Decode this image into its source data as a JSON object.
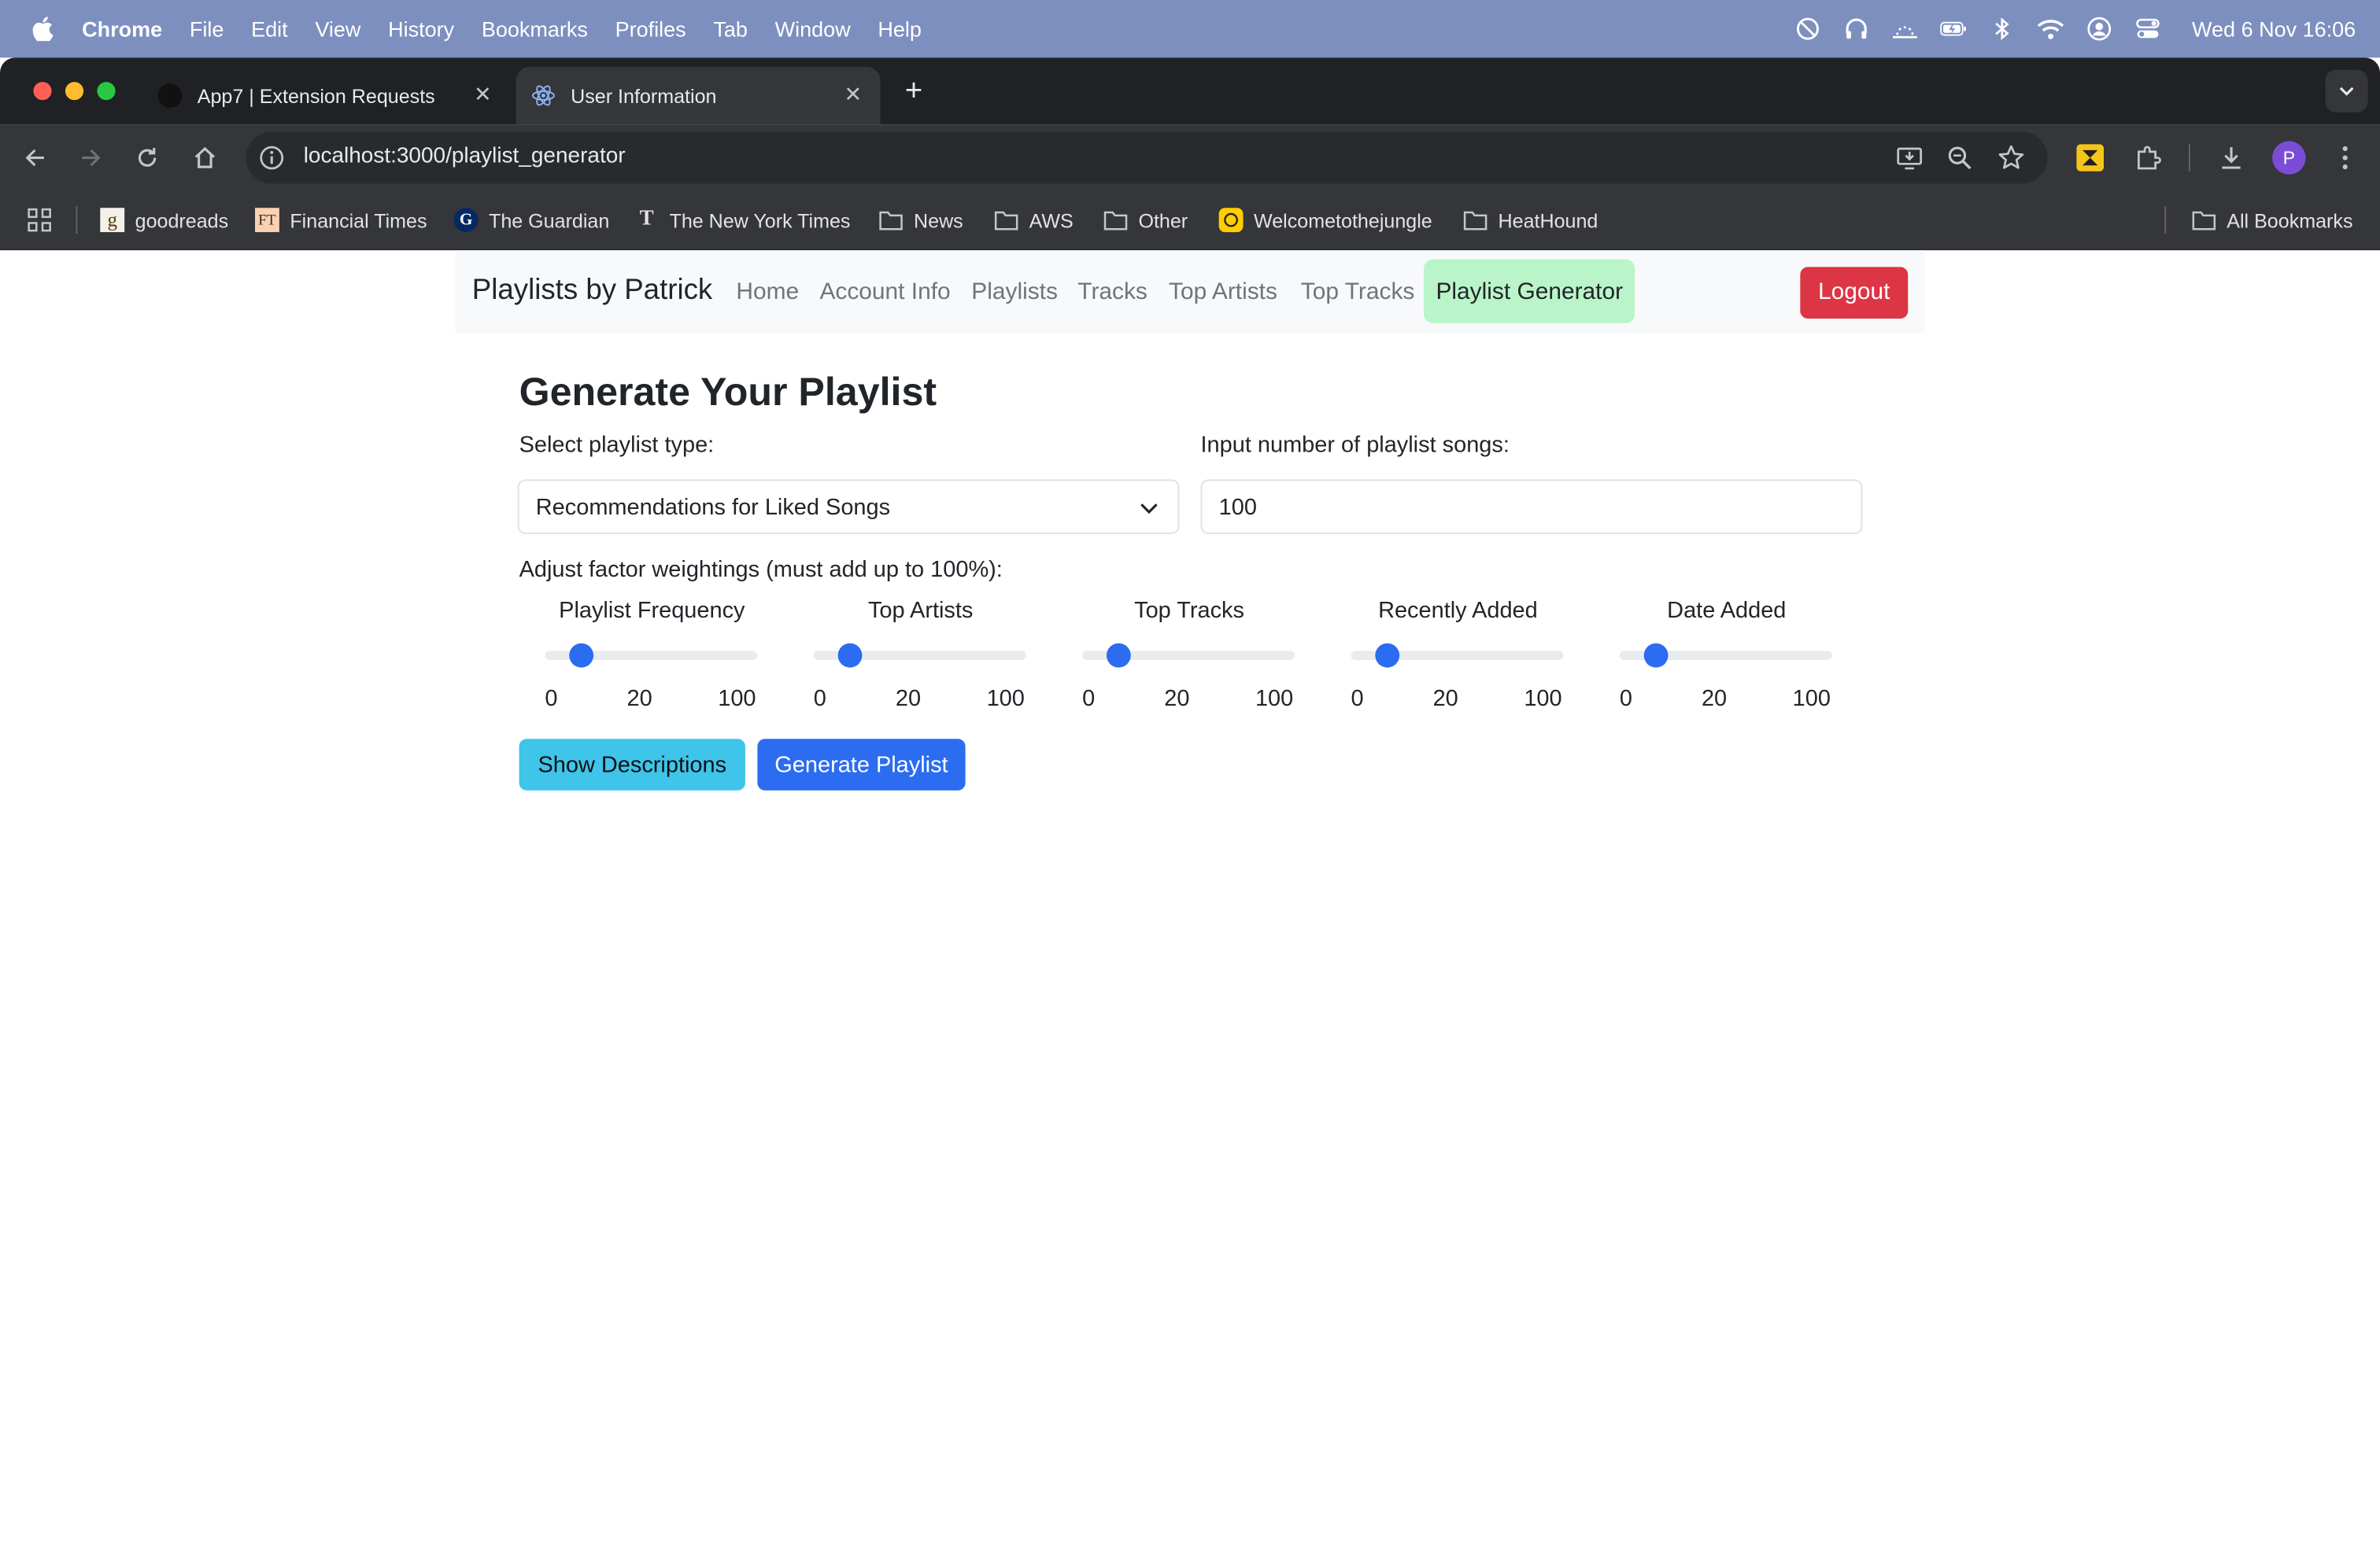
{
  "menubar": {
    "app_name": "Chrome",
    "menus": [
      "File",
      "Edit",
      "View",
      "History",
      "Bookmarks",
      "Profiles",
      "Tab",
      "Window",
      "Help"
    ],
    "clock": "Wed 6 Nov  16:06"
  },
  "tabs": [
    {
      "title": "App7 | Extension Requests",
      "active": false
    },
    {
      "title": "User Information",
      "active": true
    }
  ],
  "address_bar": {
    "url": "localhost:3000/playlist_generator"
  },
  "profile_initial": "P",
  "bookmarks": [
    {
      "label": "goodreads",
      "icon": "goodreads-icon"
    },
    {
      "label": "Financial Times",
      "icon": "ft-icon"
    },
    {
      "label": "The Guardian",
      "icon": "guardian-icon"
    },
    {
      "label": "The New York Times",
      "icon": "nyt-icon"
    },
    {
      "label": "News",
      "icon": "folder-icon"
    },
    {
      "label": "AWS",
      "icon": "folder-icon"
    },
    {
      "label": "Other",
      "icon": "folder-icon"
    },
    {
      "label": "Welcometothejungle",
      "icon": "wttj-icon"
    },
    {
      "label": "HeatHound",
      "icon": "folder-icon"
    }
  ],
  "all_bookmarks_label": "All Bookmarks",
  "navbar": {
    "brand": "Playlists by Patrick",
    "links": [
      "Home",
      "Account Info",
      "Playlists",
      "Tracks",
      "Top Artists",
      "Top Tracks"
    ],
    "active_link": "Playlist Generator",
    "logout_label": "Logout"
  },
  "form": {
    "title": "Generate Your Playlist",
    "type_label": "Select playlist type:",
    "type_value": "Recommendations for Liked Songs",
    "count_label": "Input number of playlist songs:",
    "count_value": "100",
    "weights_label": "Adjust factor weightings (must add up to 100%):",
    "factors": [
      {
        "name": "Playlist Frequency",
        "min": "0",
        "mid": "20",
        "max": "100",
        "value": 20
      },
      {
        "name": "Top Artists",
        "min": "0",
        "mid": "20",
        "max": "100",
        "value": 20
      },
      {
        "name": "Top Tracks",
        "min": "0",
        "mid": "20",
        "max": "100",
        "value": 20
      },
      {
        "name": "Recently Added",
        "min": "0",
        "mid": "20",
        "max": "100",
        "value": 20
      },
      {
        "name": "Date Added",
        "min": "0",
        "mid": "20",
        "max": "100",
        "value": 20
      }
    ],
    "show_descriptions_label": "Show Descriptions",
    "generate_label": "Generate Playlist"
  },
  "colors": {
    "menubar_bg": "#7d8fbf",
    "active_nav_bg": "#b9f5c9",
    "logout_bg": "#dc3545",
    "primary": "#2b6cf0",
    "info": "#3fc4ea"
  }
}
